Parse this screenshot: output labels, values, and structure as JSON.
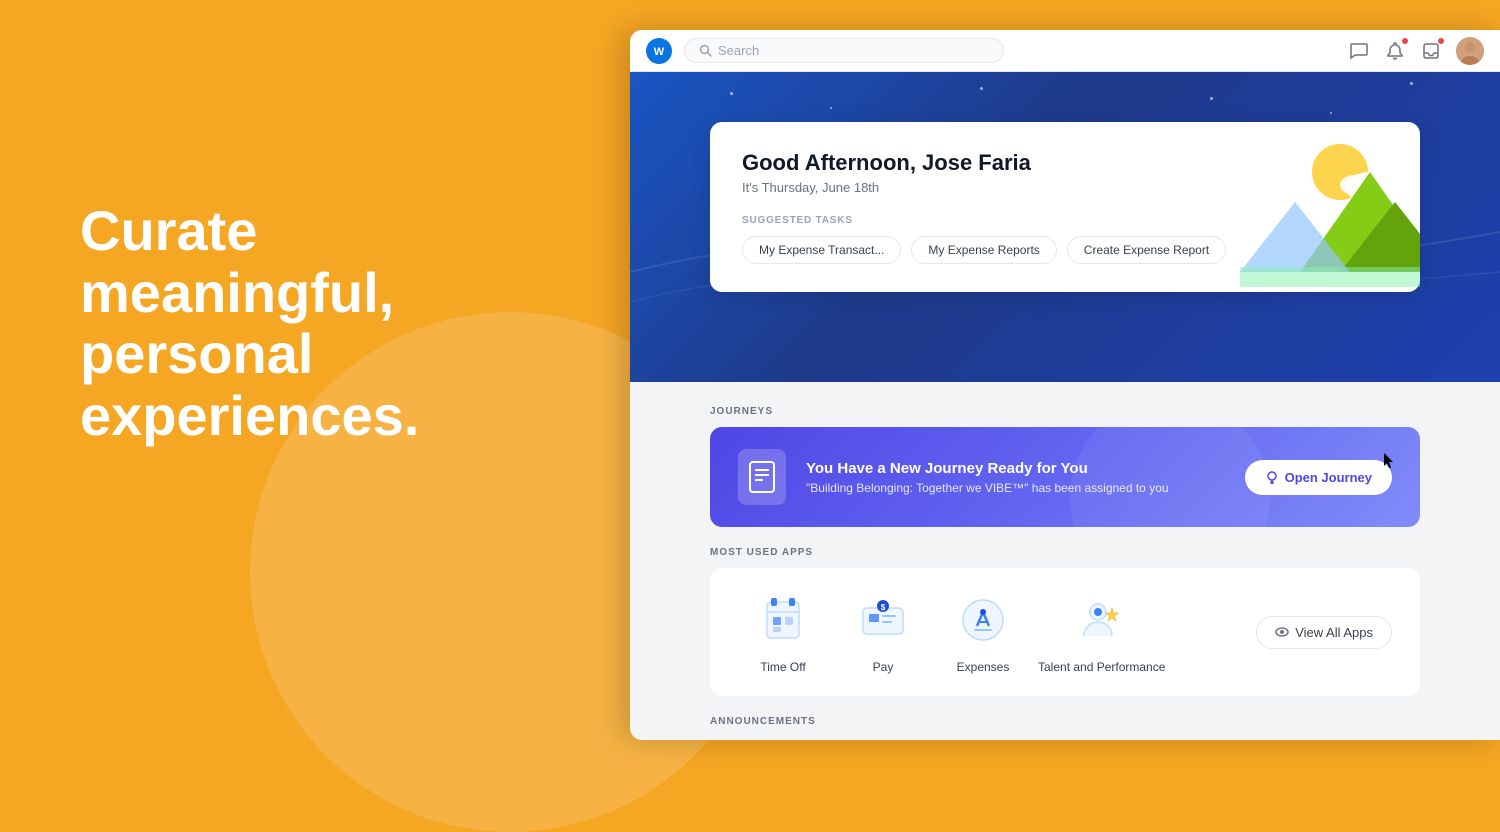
{
  "page": {
    "background_color": "#F5A623"
  },
  "left_panel": {
    "headline": "Curate meaningful, personal experiences."
  },
  "browser": {
    "search_placeholder": "Search",
    "hero": {
      "greeting": "Good Afternoon, Jose Faria",
      "date": "It's Thursday, June 18th",
      "suggested_tasks_label": "SUGGESTED TASKS",
      "tasks": [
        {
          "label": "My Expense Transact..."
        },
        {
          "label": "My Expense Reports"
        },
        {
          "label": "Create Expense Report"
        }
      ]
    },
    "journeys": {
      "section_label": "JOURNEYS",
      "card": {
        "title": "You Have a New Journey Ready for You",
        "subtitle": "\"Building Belonging: Together we VIBE™\" has been assigned to you",
        "button_label": "Open Journey"
      }
    },
    "most_used_apps": {
      "section_label": "MOST USED APPS",
      "apps": [
        {
          "id": "time-off",
          "label": "Time Off"
        },
        {
          "id": "pay",
          "label": "Pay"
        },
        {
          "id": "expenses",
          "label": "Expenses"
        },
        {
          "id": "talent",
          "label": "Talent and Performance"
        }
      ],
      "view_all_label": "View All Apps"
    },
    "announcements": {
      "section_label": "ANNOUNCEMENTS"
    }
  },
  "icons": {
    "search": "🔍",
    "message": "💬",
    "bell": "🔔",
    "inbox": "📥",
    "eye": "👁",
    "location_pin": "📍"
  }
}
